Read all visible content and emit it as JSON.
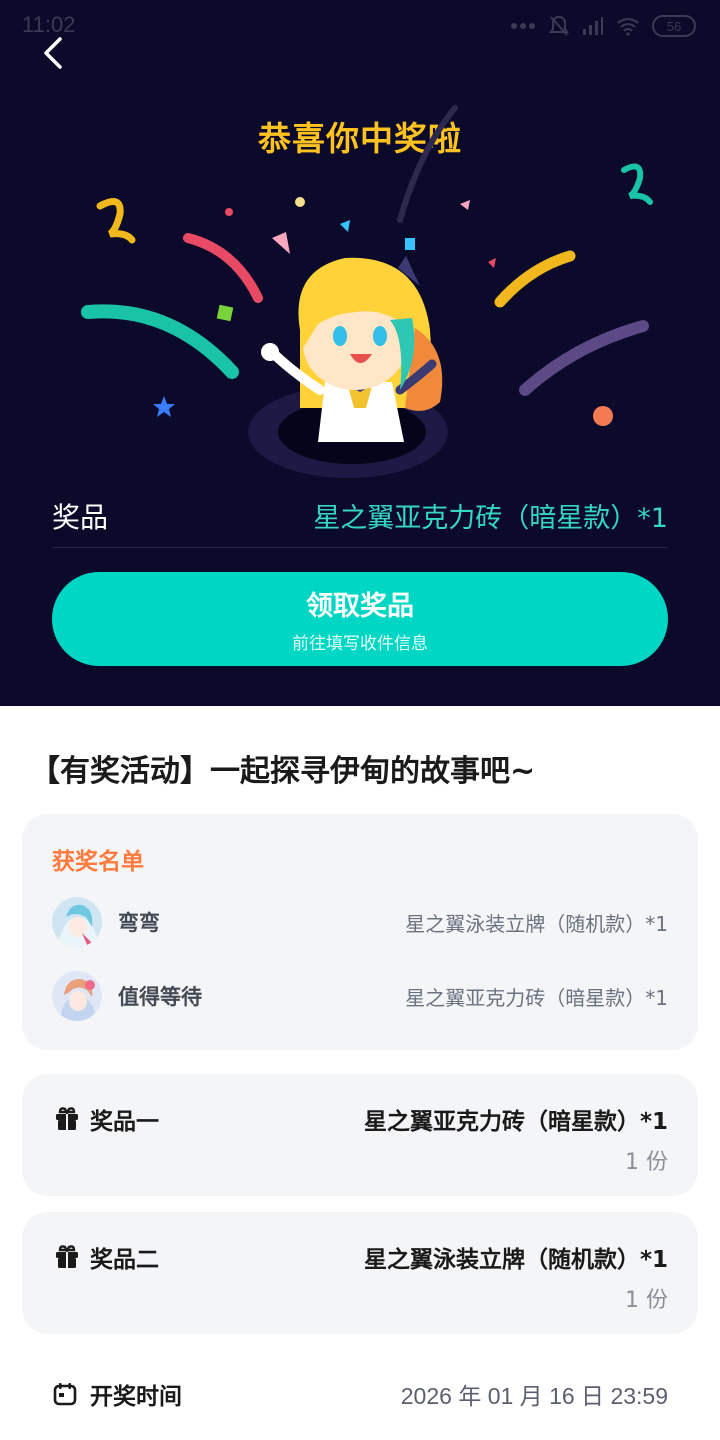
{
  "status_bar": {
    "time": "11:02",
    "battery": "56"
  },
  "hero": {
    "title": "恭喜你中奖啦",
    "prize_label": "奖品",
    "prize_value": "星之翼亚克力砖（暗星款）*1",
    "claim_button": {
      "label": "领取奖品",
      "sublabel": "前往填写收件信息"
    }
  },
  "activity": {
    "title": "【有奖活动】一起探寻伊甸的故事吧~"
  },
  "winners": {
    "heading": "获奖名单",
    "rows": [
      {
        "name": "弯弯",
        "prize": "星之翼泳装立牌（随机款）*1"
      },
      {
        "name": "值得等待",
        "prize": "星之翼亚克力砖（暗星款）*1"
      }
    ]
  },
  "prizes": [
    {
      "title": "奖品一",
      "name": "星之翼亚克力砖（暗星款）*1",
      "quantity": "1 份"
    },
    {
      "title": "奖品二",
      "name": "星之翼泳装立牌（随机款）*1",
      "quantity": "1 份"
    }
  ],
  "draw_time": {
    "label": "开奖时间",
    "value": "2026 年 01 月 16 日 23:59"
  },
  "colors": {
    "hero_bg": "#0c0a2b",
    "accent_teal": "#00d6c4",
    "title_gold": "#ffc21f",
    "winner_heading": "#ff7a3d"
  }
}
